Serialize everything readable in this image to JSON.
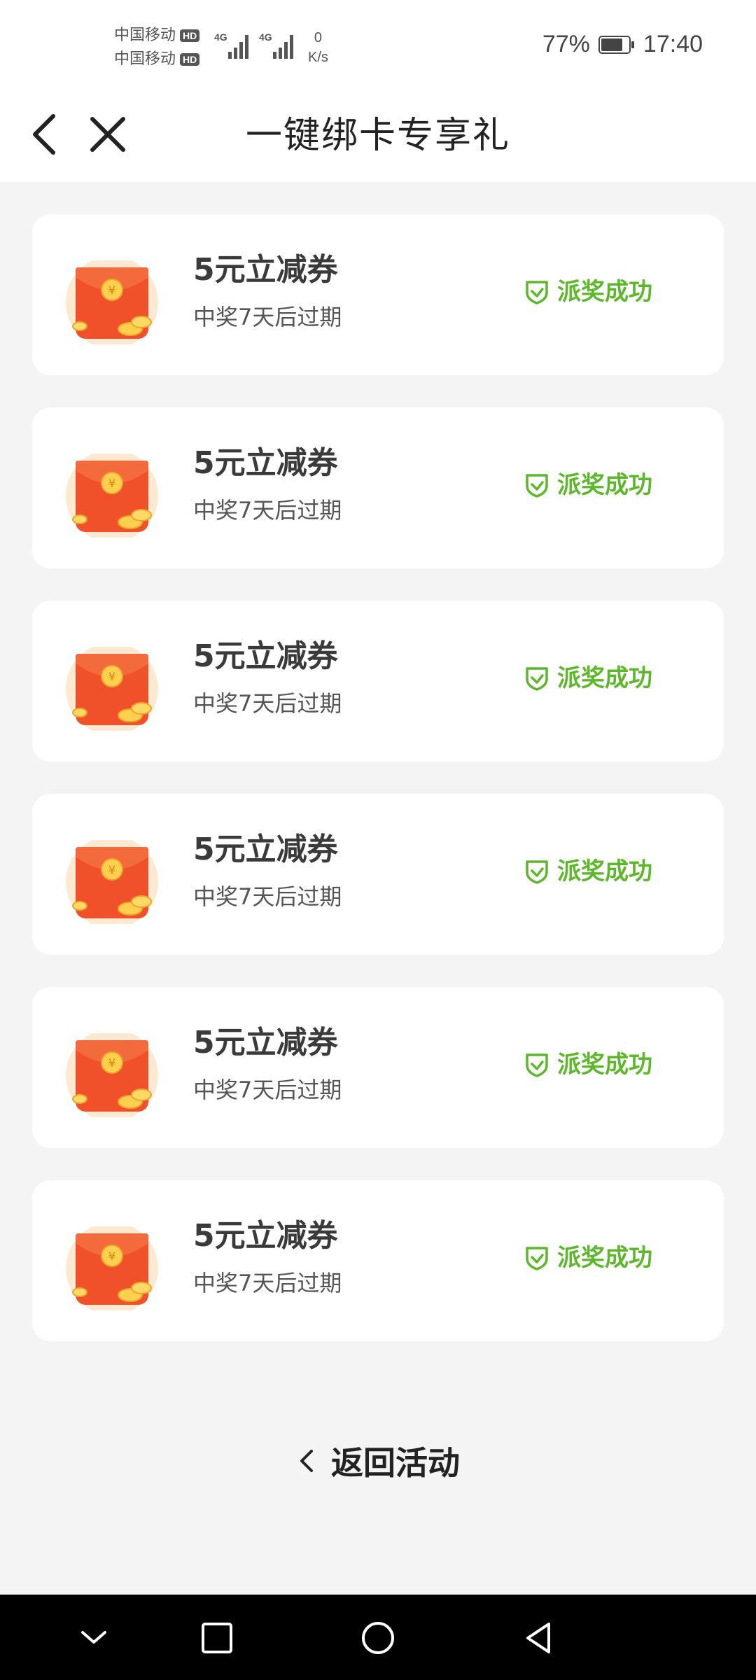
{
  "statusbar": {
    "carrier1": "中国移动",
    "carrier2": "中国移动",
    "hd": "HD",
    "net_type": "4G",
    "speed_value": "0",
    "speed_unit": "K/s",
    "battery": "77%",
    "time": "17:40"
  },
  "header": {
    "title": "一键绑卡专享礼",
    "back_icon": "chevron-left-icon",
    "close_icon": "close-icon"
  },
  "rewards": [
    {
      "name": "5元立减券",
      "note": "中奖7天后过期",
      "status": "派奖成功"
    },
    {
      "name": "5元立减券",
      "note": "中奖7天后过期",
      "status": "派奖成功"
    },
    {
      "name": "5元立减券",
      "note": "中奖7天后过期",
      "status": "派奖成功"
    },
    {
      "name": "5元立减券",
      "note": "中奖7天后过期",
      "status": "派奖成功"
    },
    {
      "name": "5元立减券",
      "note": "中奖7天后过期",
      "status": "派奖成功"
    },
    {
      "name": "5元立减券",
      "note": "中奖7天后过期",
      "status": "派奖成功"
    }
  ],
  "footer": {
    "back_label": "返回活动"
  },
  "colors": {
    "success": "#5cb82a",
    "envelope": "#ee4a24",
    "background": "#f4f4f4"
  },
  "navbar": {
    "icons": [
      "chevron-down-icon",
      "square-icon",
      "circle-home-icon",
      "triangle-back-icon"
    ]
  }
}
